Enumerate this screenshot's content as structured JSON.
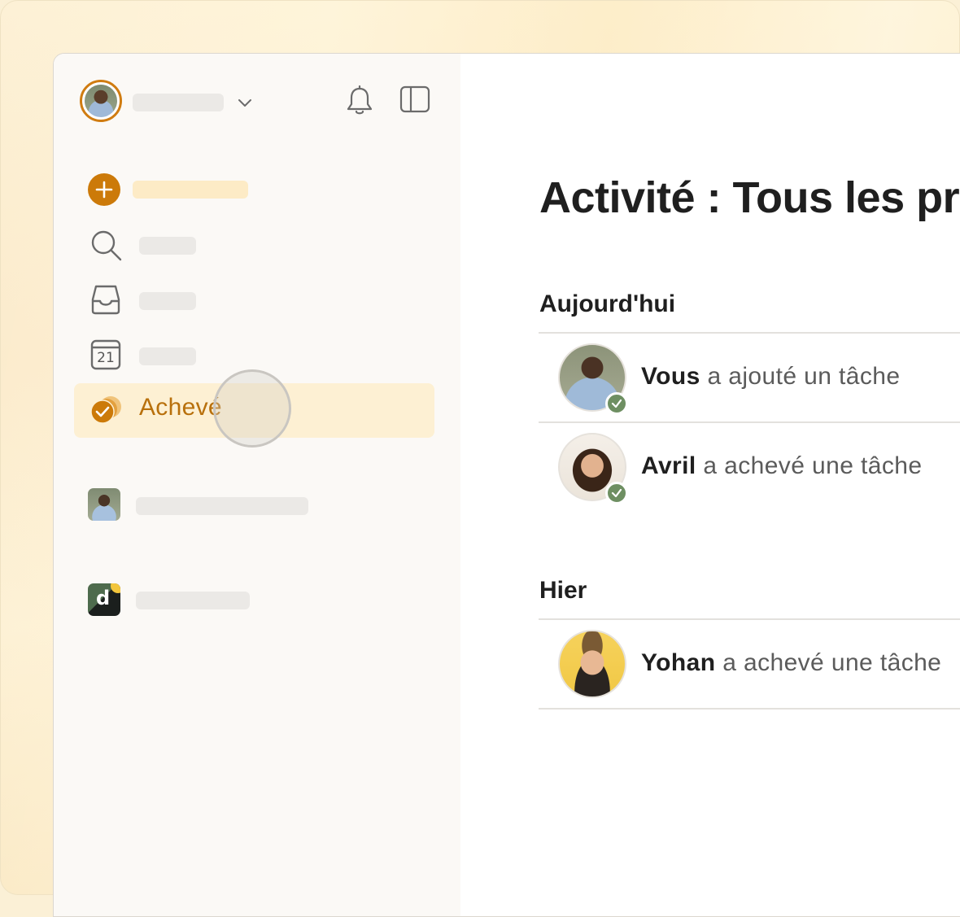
{
  "sidebar": {
    "selected_item": {
      "label": "Achevé",
      "icon": "completed-icon"
    },
    "nav_icons": [
      "plus-icon",
      "search-icon",
      "inbox-icon",
      "calendar-icon"
    ],
    "calendar_day": "21",
    "projects": [
      {
        "icon": "project-avatar"
      },
      {
        "icon": "project-logo",
        "letter": "d"
      }
    ]
  },
  "header_icons": [
    "chevron-down-icon",
    "bell-icon",
    "sidebar-toggle-icon"
  ],
  "main": {
    "title": "Activité : Tous les pro",
    "sections": [
      {
        "title": "Aujourd'hui",
        "items": [
          {
            "who": "Vous",
            "action": " a ajouté un tâche"
          },
          {
            "who": "Avril",
            "action": " a achevé une tâche"
          }
        ]
      },
      {
        "title": "Hier",
        "items": [
          {
            "who": "Yohan",
            "action": " a achevé une tâche"
          }
        ]
      }
    ]
  },
  "colors": {
    "accent": "#cc7a09",
    "selected_bg": "#fdf0d3",
    "check_badge": "#6e8f62"
  }
}
